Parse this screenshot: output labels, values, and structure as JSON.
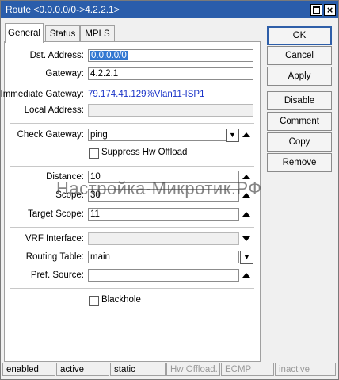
{
  "window": {
    "title": "Route <0.0.0.0/0->4.2.2.1>"
  },
  "tabs": [
    "General",
    "Status",
    "MPLS"
  ],
  "form": {
    "dst_address": {
      "label": "Dst. Address:",
      "value": "0.0.0.0/0"
    },
    "gateway": {
      "label": "Gateway:",
      "value": "4.2.2.1"
    },
    "immediate_gateway": {
      "label": "Immediate Gateway:",
      "value": "79.174.41.129%Vlan11-ISP1"
    },
    "local_address": {
      "label": "Local Address:",
      "value": ""
    },
    "check_gateway": {
      "label": "Check Gateway:",
      "value": "ping"
    },
    "suppress_hw_offload": {
      "label": "Suppress Hw Offload",
      "checked": false
    },
    "distance": {
      "label": "Distance:",
      "value": "10"
    },
    "scope": {
      "label": "Scope:",
      "value": "30"
    },
    "target_scope": {
      "label": "Target Scope:",
      "value": "11"
    },
    "vrf_interface": {
      "label": "VRF Interface:",
      "value": ""
    },
    "routing_table": {
      "label": "Routing Table:",
      "value": "main"
    },
    "pref_source": {
      "label": "Pref. Source:",
      "value": ""
    },
    "blackhole": {
      "label": "Blackhole",
      "checked": false
    }
  },
  "buttons": {
    "ok": "OK",
    "cancel": "Cancel",
    "apply": "Apply",
    "disable": "Disable",
    "comment": "Comment",
    "copy": "Copy",
    "remove": "Remove"
  },
  "statusbar": [
    "enabled",
    "active",
    "static",
    "Hw Offload...",
    "ECMP",
    "inactive"
  ],
  "watermark": "Настройка-Микротик.РФ",
  "colors": {
    "titlebar": "#2a5dab",
    "selection": "#3277d1",
    "link": "#1a33c8"
  }
}
